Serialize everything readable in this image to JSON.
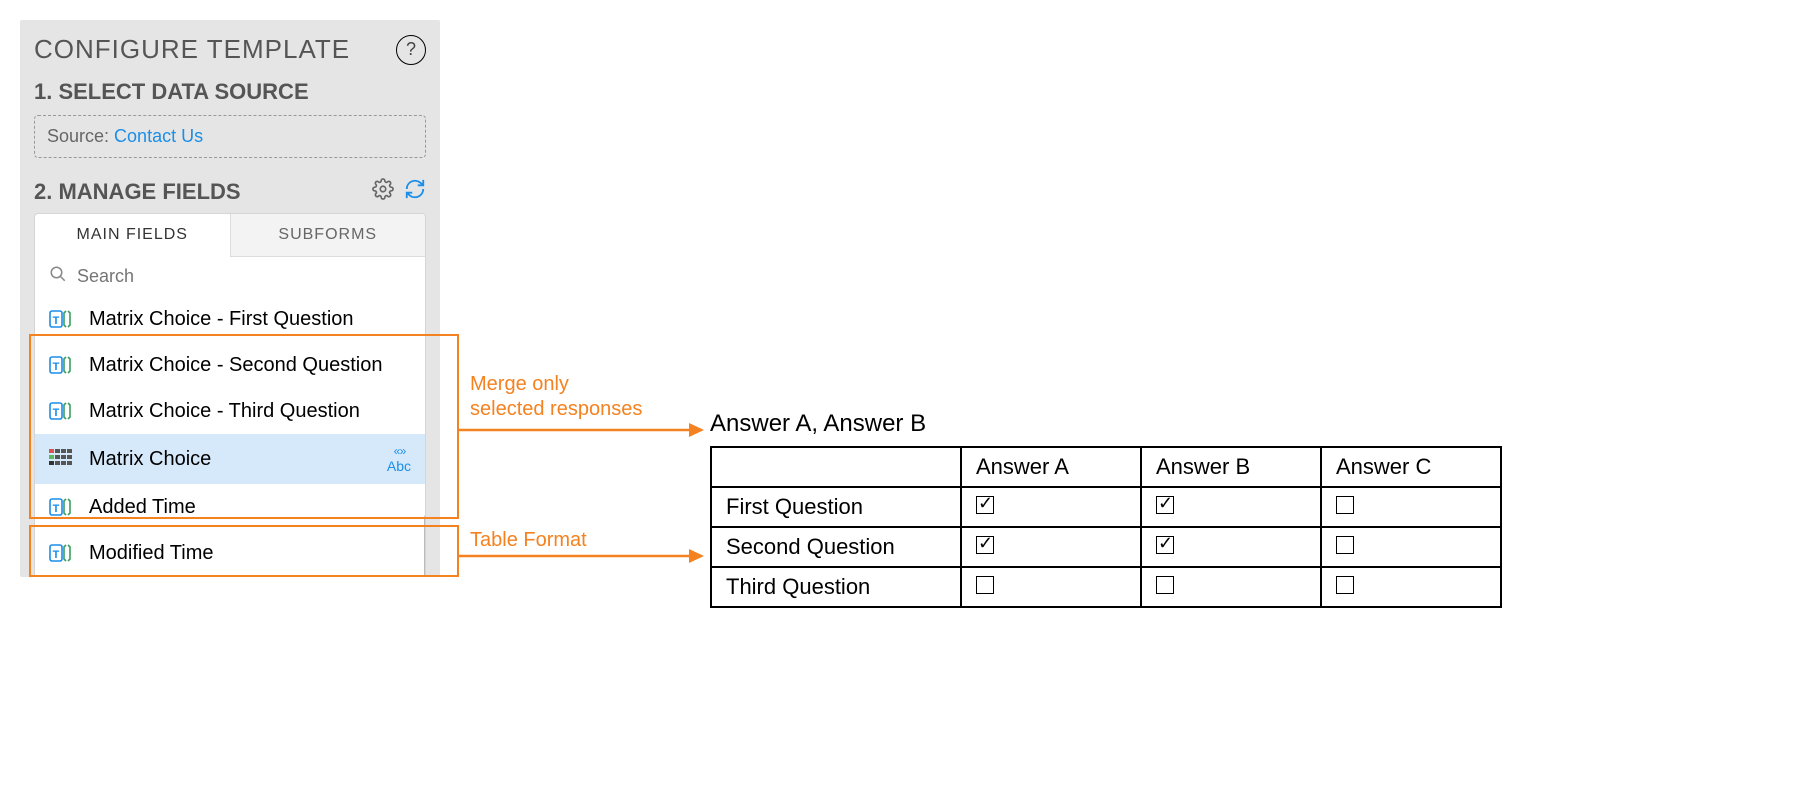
{
  "panel": {
    "title": "CONFIGURE TEMPLATE",
    "section1_title": "1. SELECT DATA SOURCE",
    "source_label": "Source: ",
    "source_value": "Contact Us",
    "section2_title": "2. MANAGE FIELDS",
    "tabs": {
      "main": "MAIN FIELDS",
      "sub": "SUBFORMS"
    },
    "search_placeholder": "Search",
    "fields": [
      {
        "label": "Matrix Choice - First Question",
        "type": "text"
      },
      {
        "label": "Matrix Choice - Second Question",
        "type": "text"
      },
      {
        "label": "Matrix Choice - Third Question",
        "type": "text"
      },
      {
        "label": "Matrix Choice",
        "type": "matrix",
        "selected": true
      },
      {
        "label": "Added Time",
        "type": "text"
      },
      {
        "label": "Modified Time",
        "type": "text"
      }
    ],
    "abc_label": "Abc"
  },
  "annotations": {
    "merge": "Merge only\nselected responses",
    "table": "Table Format"
  },
  "output": {
    "answers_line": "Answer A, Answer B",
    "columns": [
      "Answer A",
      "Answer B",
      "Answer C"
    ],
    "rows": [
      {
        "q": "First Question",
        "cells": [
          true,
          true,
          false
        ]
      },
      {
        "q": "Second Question",
        "cells": [
          true,
          true,
          false
        ]
      },
      {
        "q": "Third Question",
        "cells": [
          false,
          false,
          false
        ]
      }
    ]
  }
}
